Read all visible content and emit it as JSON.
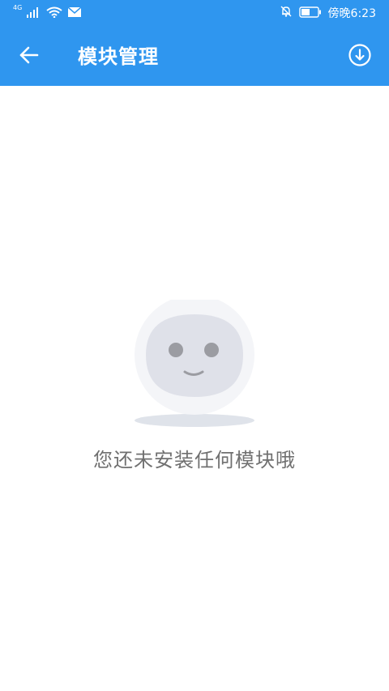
{
  "status_bar": {
    "network_label": "4G",
    "time": "傍晚6:23",
    "icons": [
      "signal-icon",
      "wifi-icon",
      "mail-icon",
      "mute-bell-icon",
      "battery-icon"
    ]
  },
  "toolbar": {
    "title": "模块管理",
    "back_icon": "arrow-left-icon",
    "download_icon": "download-circle-icon"
  },
  "empty_state": {
    "message": "您还未安装任何模块哦",
    "illustration": "smiley-face-icon"
  },
  "colors": {
    "app_bar": "#2f96ef",
    "empty_text": "#707070",
    "face_fill": "#dfe1e9",
    "face_eyes": "#9b9ca2",
    "shadow": "#dfe3ea"
  }
}
